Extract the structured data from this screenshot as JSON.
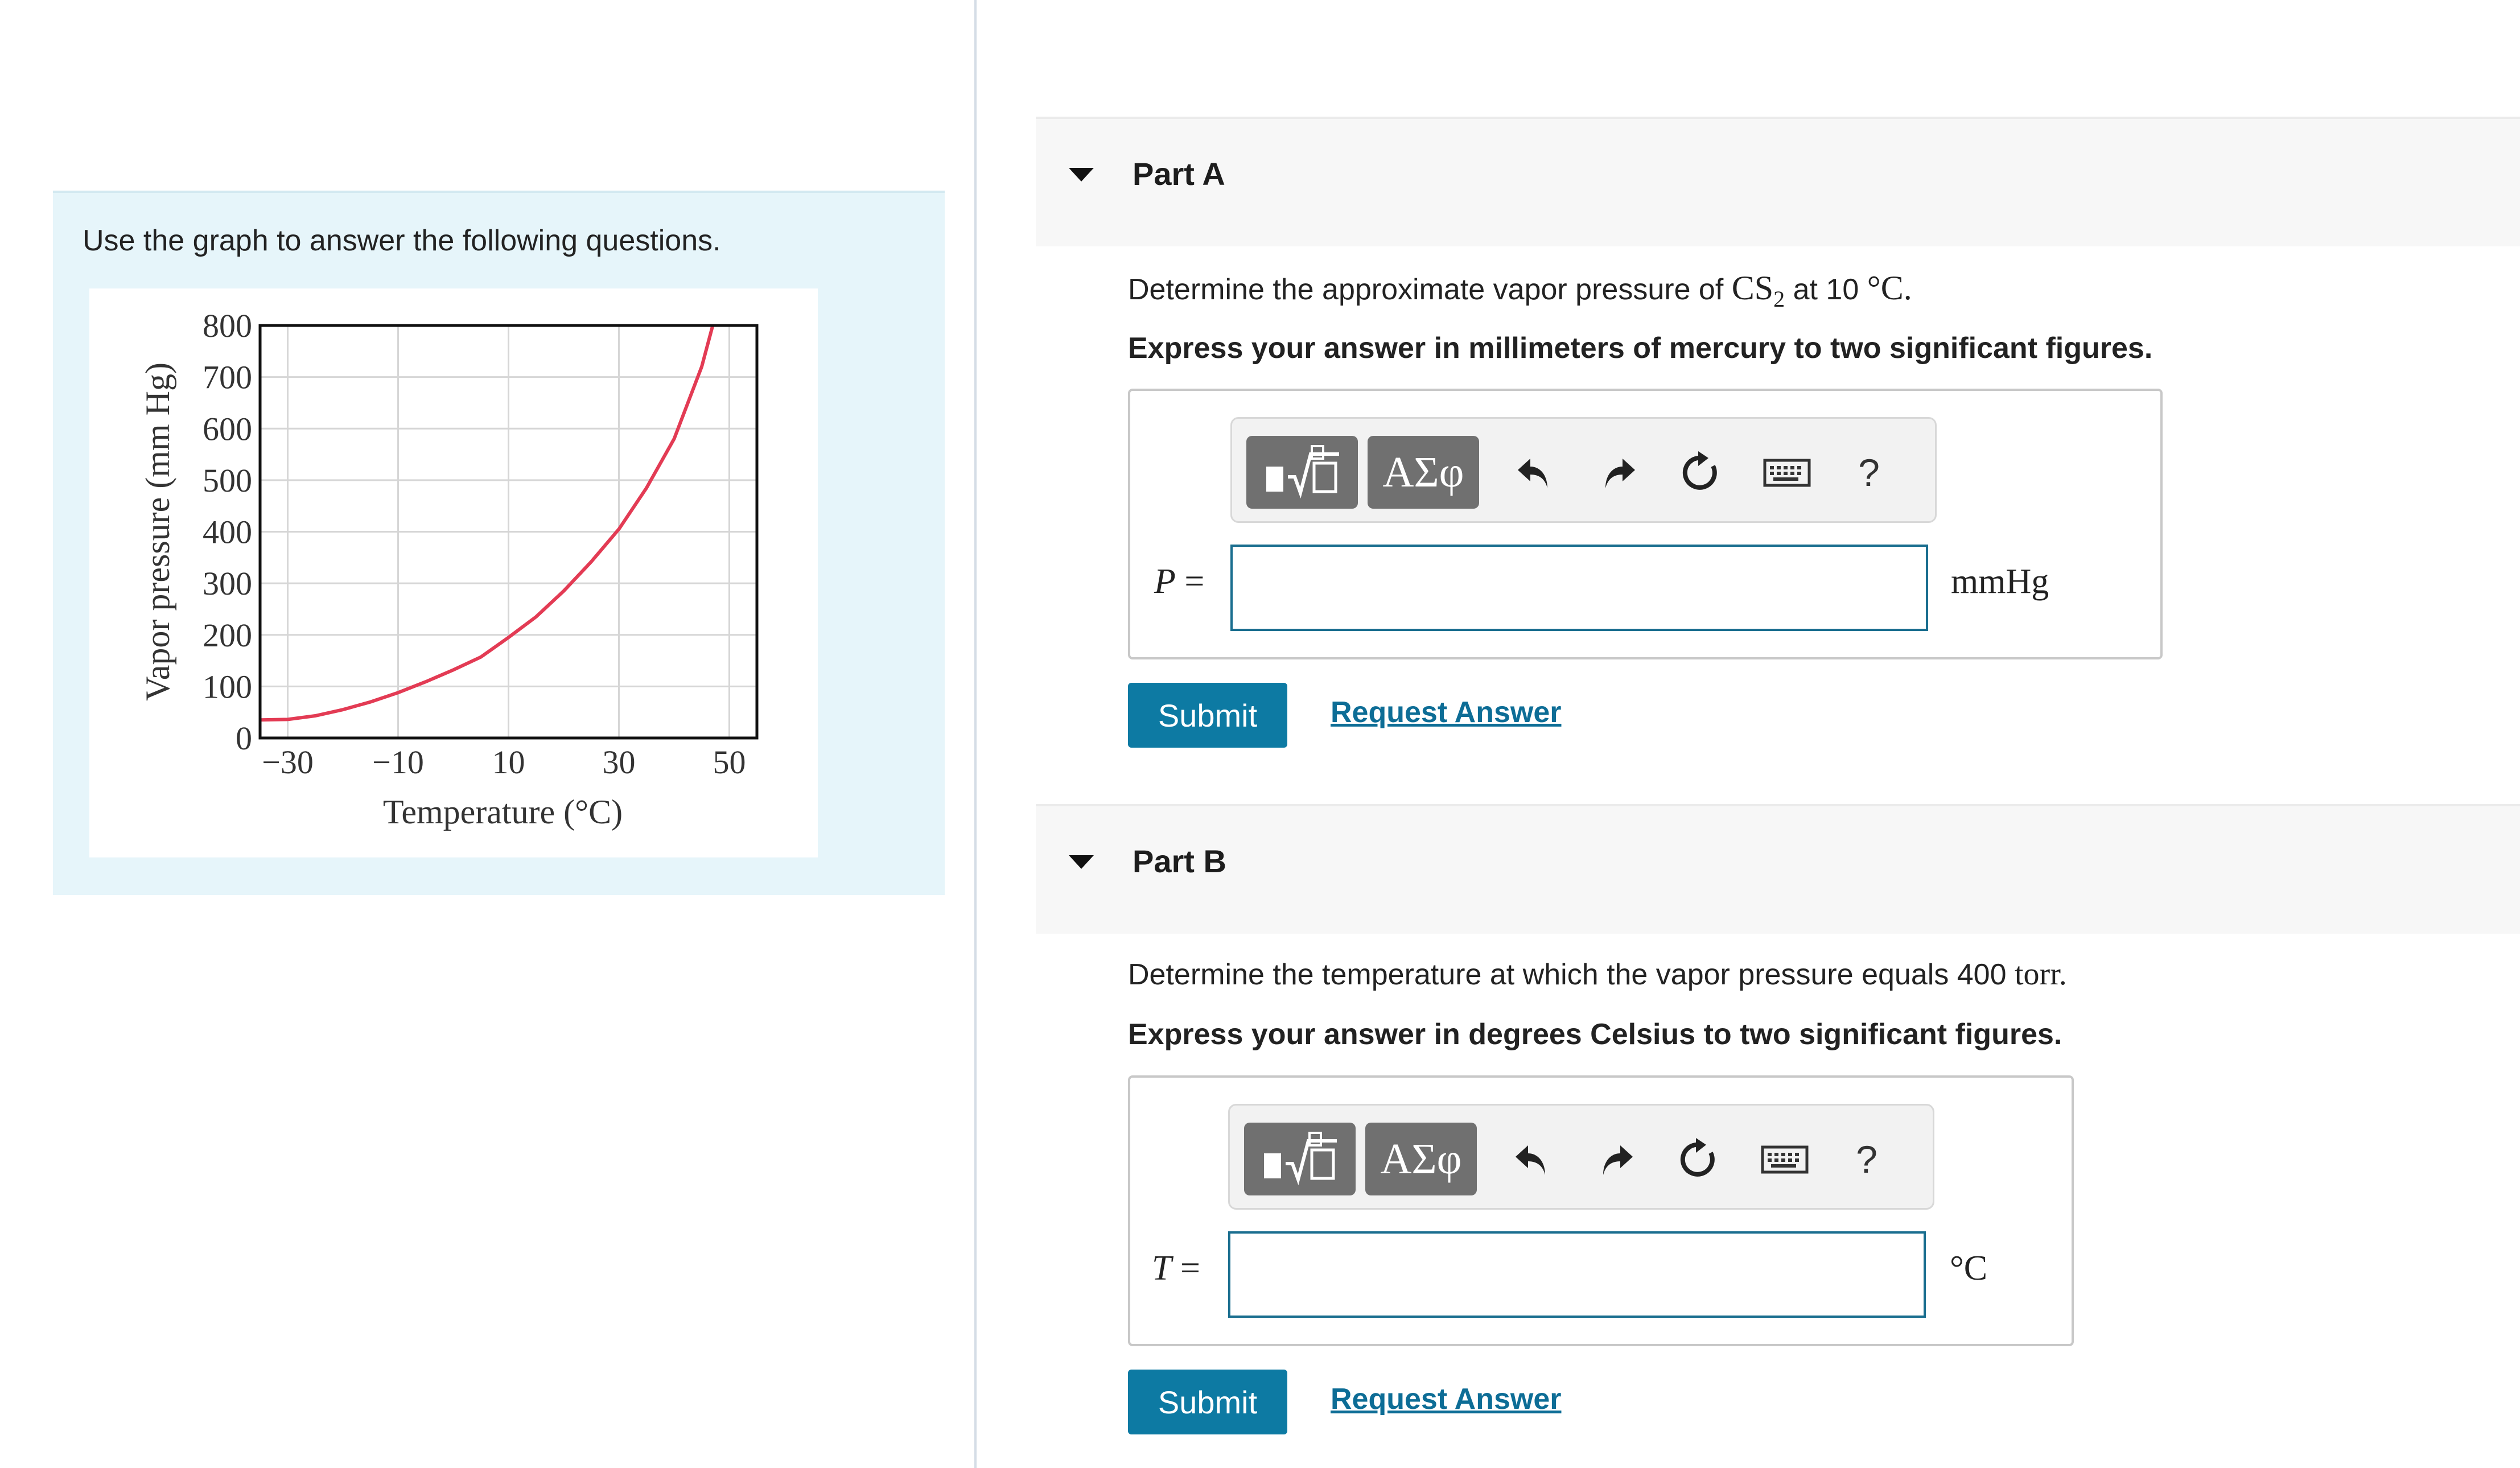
{
  "intro": {
    "text": "Use the graph to answer the following questions."
  },
  "chart_data": {
    "type": "line",
    "xlabel": "Temperature (°C)",
    "ylabel": "Vapor pressure (mm Hg)",
    "x_ticks": [
      "−30",
      "−10",
      "10",
      "30",
      "50"
    ],
    "y_ticks": [
      "0",
      "100",
      "200",
      "300",
      "400",
      "500",
      "600",
      "700",
      "800"
    ],
    "xlim": [
      -35,
      55
    ],
    "ylim": [
      0,
      800
    ],
    "grid": true,
    "series": [
      {
        "color": "#e33b54",
        "x": [
          -35,
          -30,
          -25,
          -20,
          -15,
          -10,
          -5,
          0,
          5,
          10,
          15,
          20,
          25,
          30,
          35,
          40,
          45,
          47
        ],
        "y": [
          35,
          36,
          43,
          55,
          70,
          88,
          109,
          132,
          157,
          195,
          235,
          285,
          342,
          405,
          485,
          580,
          720,
          800
        ]
      }
    ]
  },
  "part_a": {
    "title": "Part A",
    "question_prefix": "Determine the approximate vapor pressure of",
    "compound_main": "CS",
    "compound_sub": "2",
    "question_mid": "at 10",
    "question_unit": "°C.",
    "instruction": "Express your answer in millimeters of mercury to two significant figures.",
    "variable": "P",
    "equals": "=",
    "input_value": "",
    "unit": "mmHg",
    "submit_label": "Submit",
    "request_label": "Request Answer"
  },
  "part_b": {
    "title": "Part B",
    "question_prefix": "Determine the temperature at which the vapor pressure equals 400",
    "question_unit": "torr.",
    "instruction": "Express your answer in degrees Celsius to two significant figures.",
    "variable": "T",
    "equals": "=",
    "input_value": "",
    "unit": "°C",
    "submit_label": "Submit",
    "request_label": "Request Answer"
  },
  "toolbar": {
    "greek_label": "ΑΣφ",
    "help_label": "?",
    "icons": [
      "templates-icon",
      "greek-symbols-icon",
      "undo-icon",
      "redo-icon",
      "reset-icon",
      "keyboard-icon",
      "help-icon"
    ]
  },
  "colors": {
    "curve": "#e33b54",
    "submit": "#0d7aa3",
    "link": "#0d6d96",
    "input_border": "#1a6e8f",
    "intro_bg": "#e6f5fa"
  }
}
